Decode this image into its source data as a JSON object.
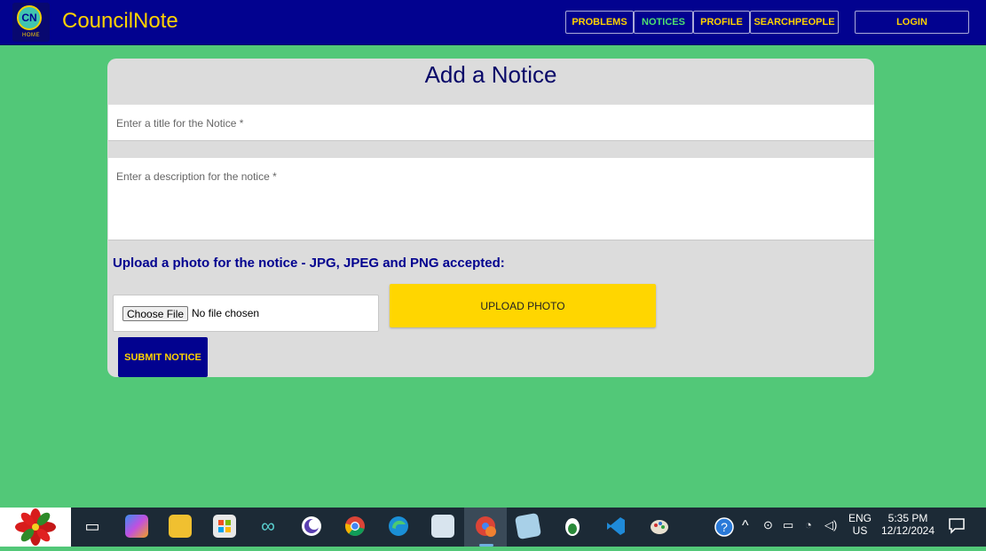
{
  "header": {
    "logo_text": "CN",
    "logo_caption": "HOME",
    "brand": "CouncilNote",
    "nav": [
      {
        "label": "PROBLEMS"
      },
      {
        "label": "NOTICES"
      },
      {
        "label": "PROFILE"
      },
      {
        "label": "SEARCHPEOPLE"
      }
    ],
    "login_label": "LOGIN"
  },
  "form": {
    "title": "Add a Notice",
    "title_placeholder": "Enter a title for the Notice *",
    "description_placeholder": "Enter a description for the notice *",
    "upload_label": "Upload a photo for the notice - JPG, JPEG and PNG accepted:",
    "choose_file_label": "Choose File",
    "no_file_text": "No file chosen",
    "upload_button": "UPLOAD PHOTO",
    "submit_button": "SUBMIT NOTICE"
  },
  "taskbar": {
    "apps": [
      "poinsettia-start",
      "task-view",
      "copilot",
      "file-explorer",
      "microsoft-store",
      "infinity-app",
      "moon-app",
      "chrome",
      "edge",
      "photos-app",
      "chrome-profile-r",
      "notepad-app",
      "linux-tux-app",
      "vscode",
      "paint-app"
    ],
    "tray": {
      "language": "ENG",
      "region": "US",
      "time": "5:35 PM",
      "date": "12/12/2024"
    }
  }
}
